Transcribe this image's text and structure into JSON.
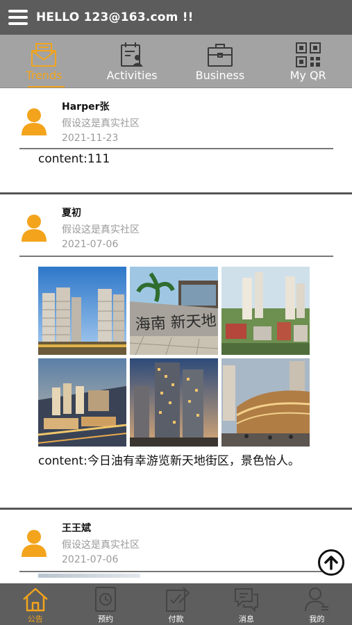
{
  "header": {
    "greeting": "HELLO 123@163.com !!",
    "menu_icon": "hamburger-menu-icon"
  },
  "tabs": [
    {
      "label": "Trends",
      "icon": "envelope-icon",
      "active": true
    },
    {
      "label": "Activities",
      "icon": "calendar-person-icon",
      "active": false
    },
    {
      "label": "Business",
      "icon": "briefcase-icon",
      "active": false
    },
    {
      "label": "My QR",
      "icon": "qr-code-icon",
      "active": false
    }
  ],
  "posts": [
    {
      "author": "Harper张",
      "community": "假设这是真实社区",
      "date": "2021-11-23",
      "content": "content:111",
      "photos": []
    },
    {
      "author": "夏初",
      "community": "假设这是真实社区",
      "date": "2021-07-06",
      "content": "content:今日油有幸游览新天地街区，景色怡人。",
      "photos": [
        "high-rise residential towers under blue sky",
        "stone wall with calligraphy and palm trees",
        "aerial view of residential district",
        "aerial night rendering of city blocks",
        "tall apartment tower at dusk",
        "curved shopping mall building at dusk"
      ]
    },
    {
      "author": "王王斌",
      "community": "假设这是真实社区",
      "date": "2021-07-06",
      "content": "",
      "photos": []
    }
  ],
  "back_to_top_icon": "arrow-up-circle-icon",
  "bottom_nav": [
    {
      "label": "公告",
      "icon": "home-icon",
      "active": true
    },
    {
      "label": "预约",
      "icon": "clock-icon",
      "active": false
    },
    {
      "label": "付款",
      "icon": "payment-icon",
      "active": false
    },
    {
      "label": "消息",
      "icon": "chat-icon",
      "active": false
    },
    {
      "label": "我的",
      "icon": "profile-icon",
      "active": false
    }
  ],
  "colors": {
    "accent": "#f3a41c",
    "header_bg": "#5c5c5c",
    "tab_bg": "#a3a3a3",
    "nav_bg": "#5e5e5e"
  }
}
